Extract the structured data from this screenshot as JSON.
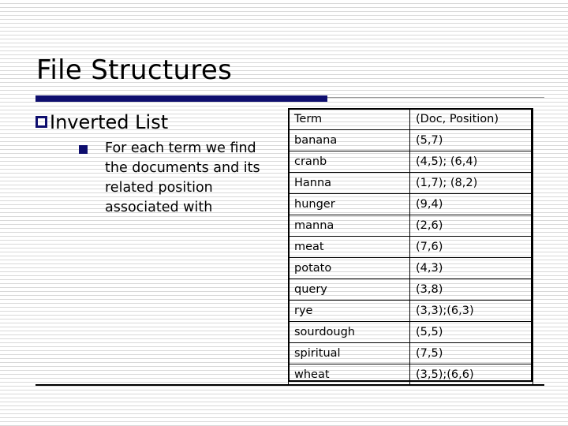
{
  "slide": {
    "title": "File Structures",
    "accent_color": "#0e0e6e",
    "rule_color": "#9a9a9a",
    "background": "#ffffff"
  },
  "bullets": {
    "level1": {
      "marker": "hollow-square-bullet",
      "text": "Inverted List"
    },
    "level2": {
      "marker": "filled-square-bullet",
      "text": "For each term we find the documents and its related position associated with"
    }
  },
  "table": {
    "headers": [
      "Term",
      "(Doc, Position)"
    ],
    "rows": [
      {
        "term": "banana",
        "positions": "(5,7)"
      },
      {
        "term": "cranb",
        "positions": "(4,5); (6,4)"
      },
      {
        "term": "Hanna",
        "positions": "(1,7); (8,2)"
      },
      {
        "term": "hunger",
        "positions": "(9,4)"
      },
      {
        "term": "manna",
        "positions": "(2,6)"
      },
      {
        "term": "meat",
        "positions": "(7,6)"
      },
      {
        "term": "potato",
        "positions": "(4,3)"
      },
      {
        "term": "query",
        "positions": "(3,8)"
      },
      {
        "term": "rye",
        "positions": "(3,3);(6,3)"
      },
      {
        "term": "sourdough",
        "positions": "(5,5)"
      },
      {
        "term": "spiritual",
        "positions": "(7,5)"
      },
      {
        "term": "wheat",
        "positions": "(3,5);(6,6)"
      }
    ]
  }
}
